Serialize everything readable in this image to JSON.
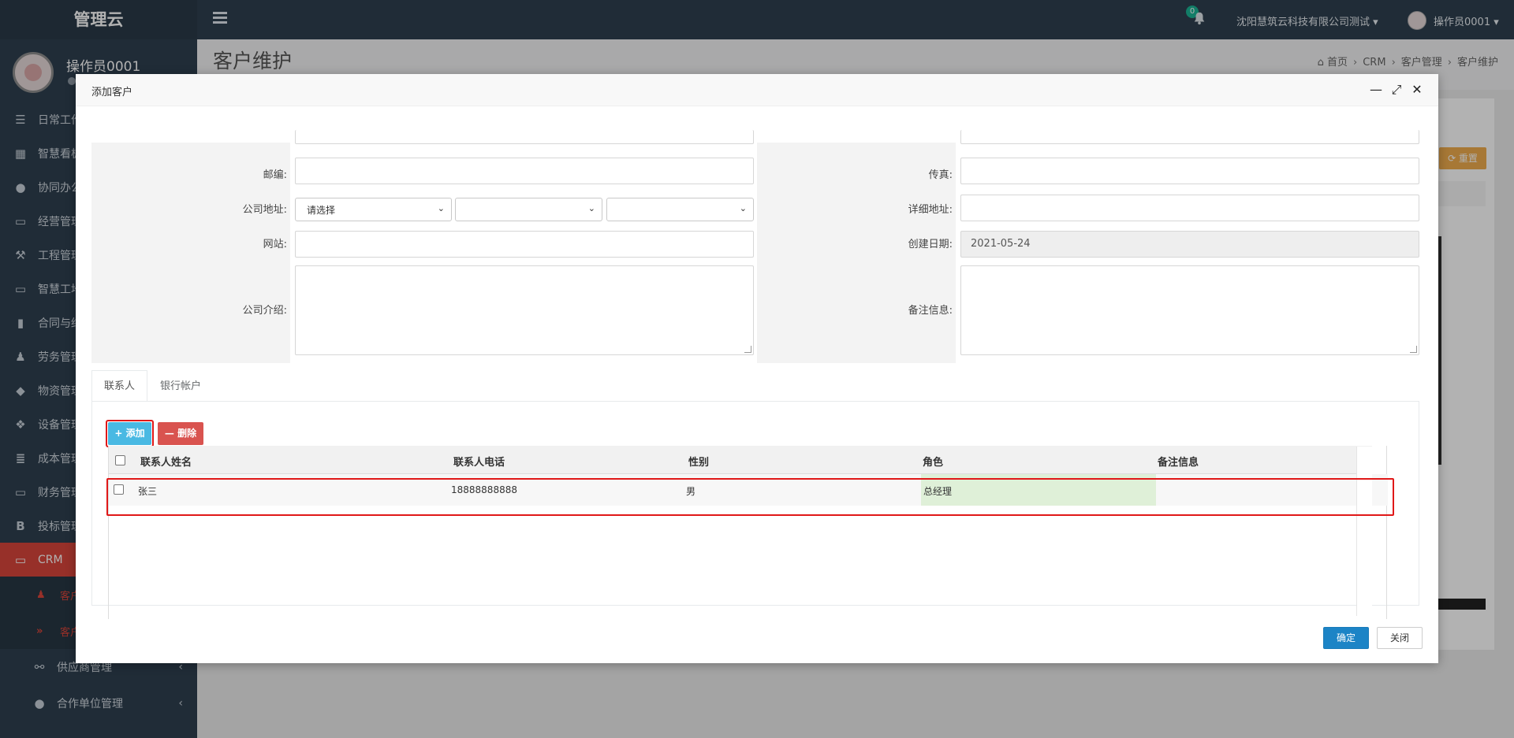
{
  "sidebar": {
    "brand": "管理云",
    "username": "操作员0001",
    "items": [
      {
        "icon": "list-indent-icon",
        "glyph": "☰",
        "label": "日常工作"
      },
      {
        "icon": "dashboard-icon",
        "glyph": "▦",
        "label": "智慧看板"
      },
      {
        "icon": "users-icon",
        "glyph": "●",
        "label": "协同办公"
      },
      {
        "icon": "monitor-icon",
        "glyph": "▭",
        "label": "经营管理"
      },
      {
        "icon": "gavel-icon",
        "glyph": "⚒",
        "label": "工程管理"
      },
      {
        "icon": "monitor-icon",
        "glyph": "▭",
        "label": "智慧工地"
      },
      {
        "icon": "file-icon",
        "glyph": "▮",
        "label": "合同与结"
      },
      {
        "icon": "worker-icon",
        "glyph": "♟",
        "label": "劳务管理"
      },
      {
        "icon": "cube-icon",
        "glyph": "◆",
        "label": "物资管理"
      },
      {
        "icon": "cubes-icon",
        "glyph": "❖",
        "label": "设备管理"
      },
      {
        "icon": "list-icon",
        "glyph": "≣",
        "label": "成本管理"
      },
      {
        "icon": "monitor-icon",
        "glyph": "▭",
        "label": "财务管理"
      },
      {
        "icon": "bold-b-icon",
        "glyph": "B",
        "label": "投标管理"
      },
      {
        "icon": "monitor-icon",
        "glyph": "▭",
        "label": "CRM"
      }
    ],
    "sub_items": [
      {
        "icon": "user-icon",
        "glyph": "♟",
        "label": "客户"
      },
      {
        "icon": "double-chevron-icon",
        "glyph": "»",
        "label": "客户"
      }
    ],
    "bottom_items": [
      {
        "icon": "link-icon",
        "glyph": "⚯",
        "label": "供应商管理"
      },
      {
        "icon": "users-icon",
        "glyph": "●",
        "label": "合作单位管理"
      }
    ],
    "caret": "‹"
  },
  "topbar": {
    "notification_count": "0",
    "company": "沈阳慧筑云科技有限公司测试 ▾",
    "user": "操作员0001 ▾"
  },
  "page": {
    "title": "客户维护",
    "breadcrumb": [
      "首页",
      "CRM",
      "客户管理",
      "客户维护"
    ],
    "reset_label": "⟳ 重置"
  },
  "modal": {
    "title": "添加客户",
    "tools": [
      "—",
      "⤢",
      "✕"
    ],
    "form": {
      "postcode_label": "邮编:",
      "fax_label": "传真:",
      "address_label": "公司地址:",
      "address_select_placeholder": "请选择",
      "detail_address_label": "详细地址:",
      "website_label": "网站:",
      "created_date_label": "创建日期:",
      "created_date_value": "2021-05-24",
      "intro_label": "公司介绍:",
      "remark_label": "备注信息:"
    },
    "tabs": [
      "联系人",
      "银行帐户"
    ],
    "add_label": "+ 添加",
    "delete_label": "— 删除",
    "table": {
      "headers": [
        "联系人姓名",
        "联系人电话",
        "性别",
        "角色",
        "备注信息"
      ],
      "rows": [
        {
          "name": "张三",
          "phone": "18888888888",
          "gender": "男",
          "role": "总经理",
          "remark": ""
        }
      ]
    },
    "ok_label": "确定",
    "close_label": "关闭"
  },
  "colors": {
    "sidebar_bg": "#2f4050",
    "active_red": "#d9463b",
    "primary_blue": "#1c84c6",
    "add_btn": "#49b9e3",
    "delete_btn": "#d9534f",
    "highlight_outline": "#e01818",
    "role_cell_bg": "#dff0d8"
  }
}
